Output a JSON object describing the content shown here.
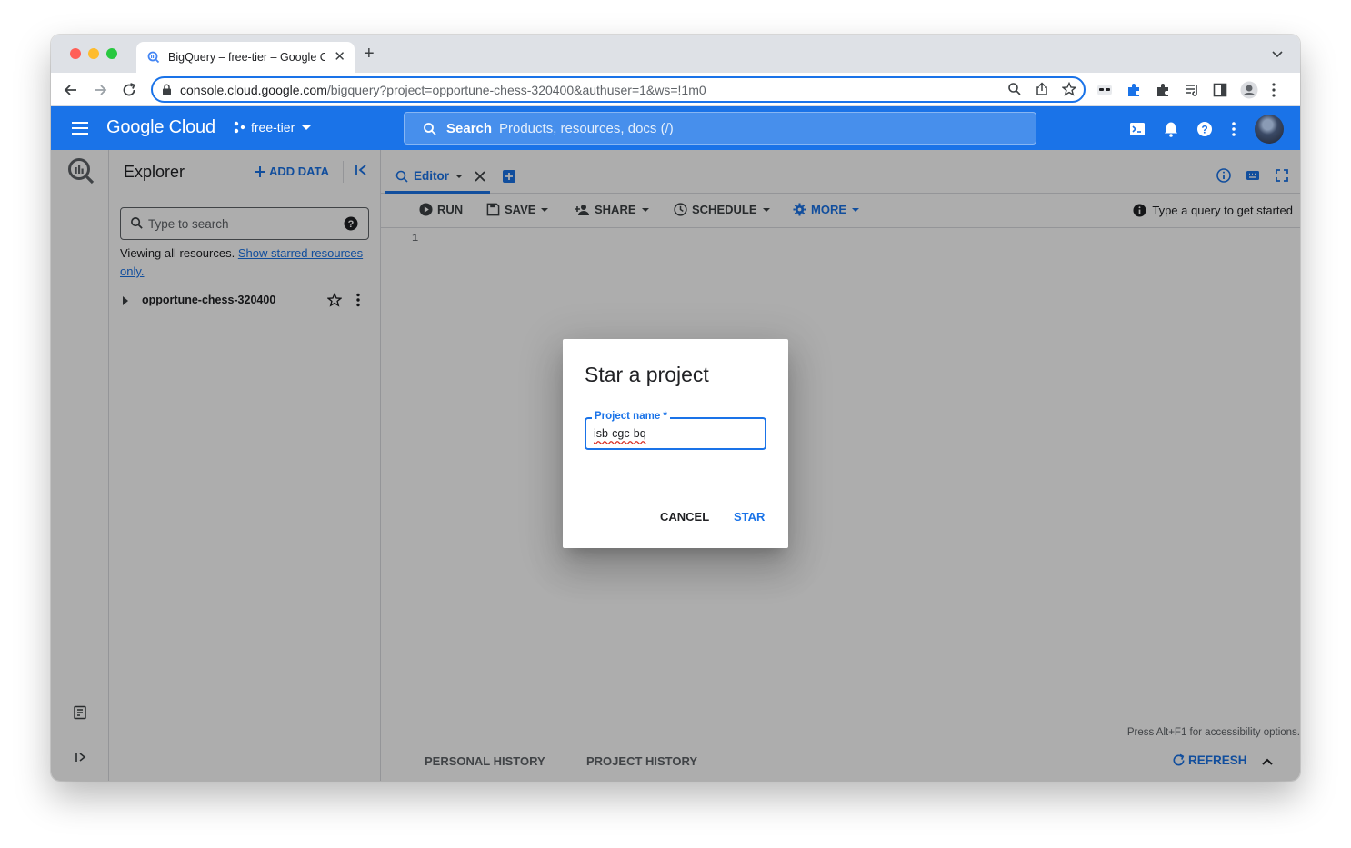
{
  "browser": {
    "tab_title": "BigQuery – free-tier – Google C",
    "url_host": "console.cloud.google.com",
    "url_path": "/bigquery?project=opportune-chess-320400&authuser=1&ws=!1m0"
  },
  "gcp_header": {
    "logo": "Google Cloud",
    "project": "free-tier",
    "search_label": "Search",
    "search_placeholder": "Products, resources, docs (/)"
  },
  "explorer": {
    "title": "Explorer",
    "add_data": "ADD DATA",
    "search_placeholder": "Type to search",
    "viewing_text": "Viewing all resources.",
    "starred_link": "Show starred resources only.",
    "project_name": "opportune-chess-320400"
  },
  "editor": {
    "tab_label": "Editor",
    "actions": {
      "run": "RUN",
      "save": "SAVE",
      "share": "SHARE",
      "schedule": "SCHEDULE",
      "more": "MORE"
    },
    "hint": "Type a query to get started",
    "line_number": "1",
    "a11y_text": "Press Alt+F1 for accessibility options."
  },
  "history": {
    "personal": "PERSONAL HISTORY",
    "project": "PROJECT HISTORY",
    "refresh": "REFRESH"
  },
  "dialog": {
    "title": "Star a project",
    "field_label": "Project name *",
    "field_value": "isb-cgc-bq",
    "cancel": "CANCEL",
    "star": "STAR"
  },
  "colors": {
    "accent": "#1a73e8",
    "header_bg": "#1a73e8",
    "overlay": "rgba(0,0,0,0.32)"
  }
}
